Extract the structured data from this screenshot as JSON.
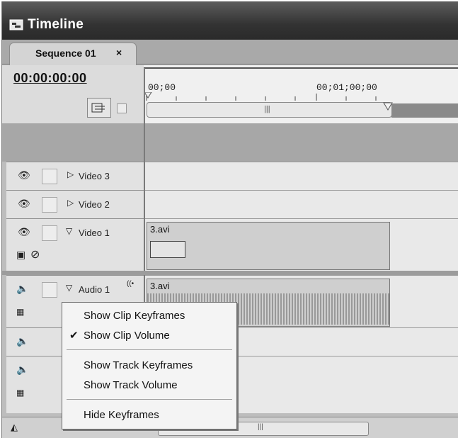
{
  "window": {
    "title": "Timeline"
  },
  "tabs": [
    {
      "label": "Sequence 01",
      "close": "×"
    }
  ],
  "header": {
    "timecode": "00:00:00:00"
  },
  "ruler": {
    "labels": [
      "00;00",
      "00;01;00;00"
    ]
  },
  "tracks": {
    "video3": {
      "label": "Video 3"
    },
    "video2": {
      "label": "Video 2"
    },
    "video1": {
      "label": "Video 1",
      "clip": "3.avi"
    },
    "audio1": {
      "label": "Audio 1",
      "clip": "3.avi"
    }
  },
  "context_menu": {
    "items": [
      {
        "label": "Show Clip Keyframes",
        "checked": false
      },
      {
        "label": "Show Clip Volume",
        "checked": true
      },
      {
        "label": "Show Track Keyframes",
        "checked": false
      },
      {
        "label": "Show Track Volume",
        "checked": false
      },
      {
        "label": "Hide Keyframes",
        "checked": false
      }
    ],
    "check_glyph": "✔"
  }
}
